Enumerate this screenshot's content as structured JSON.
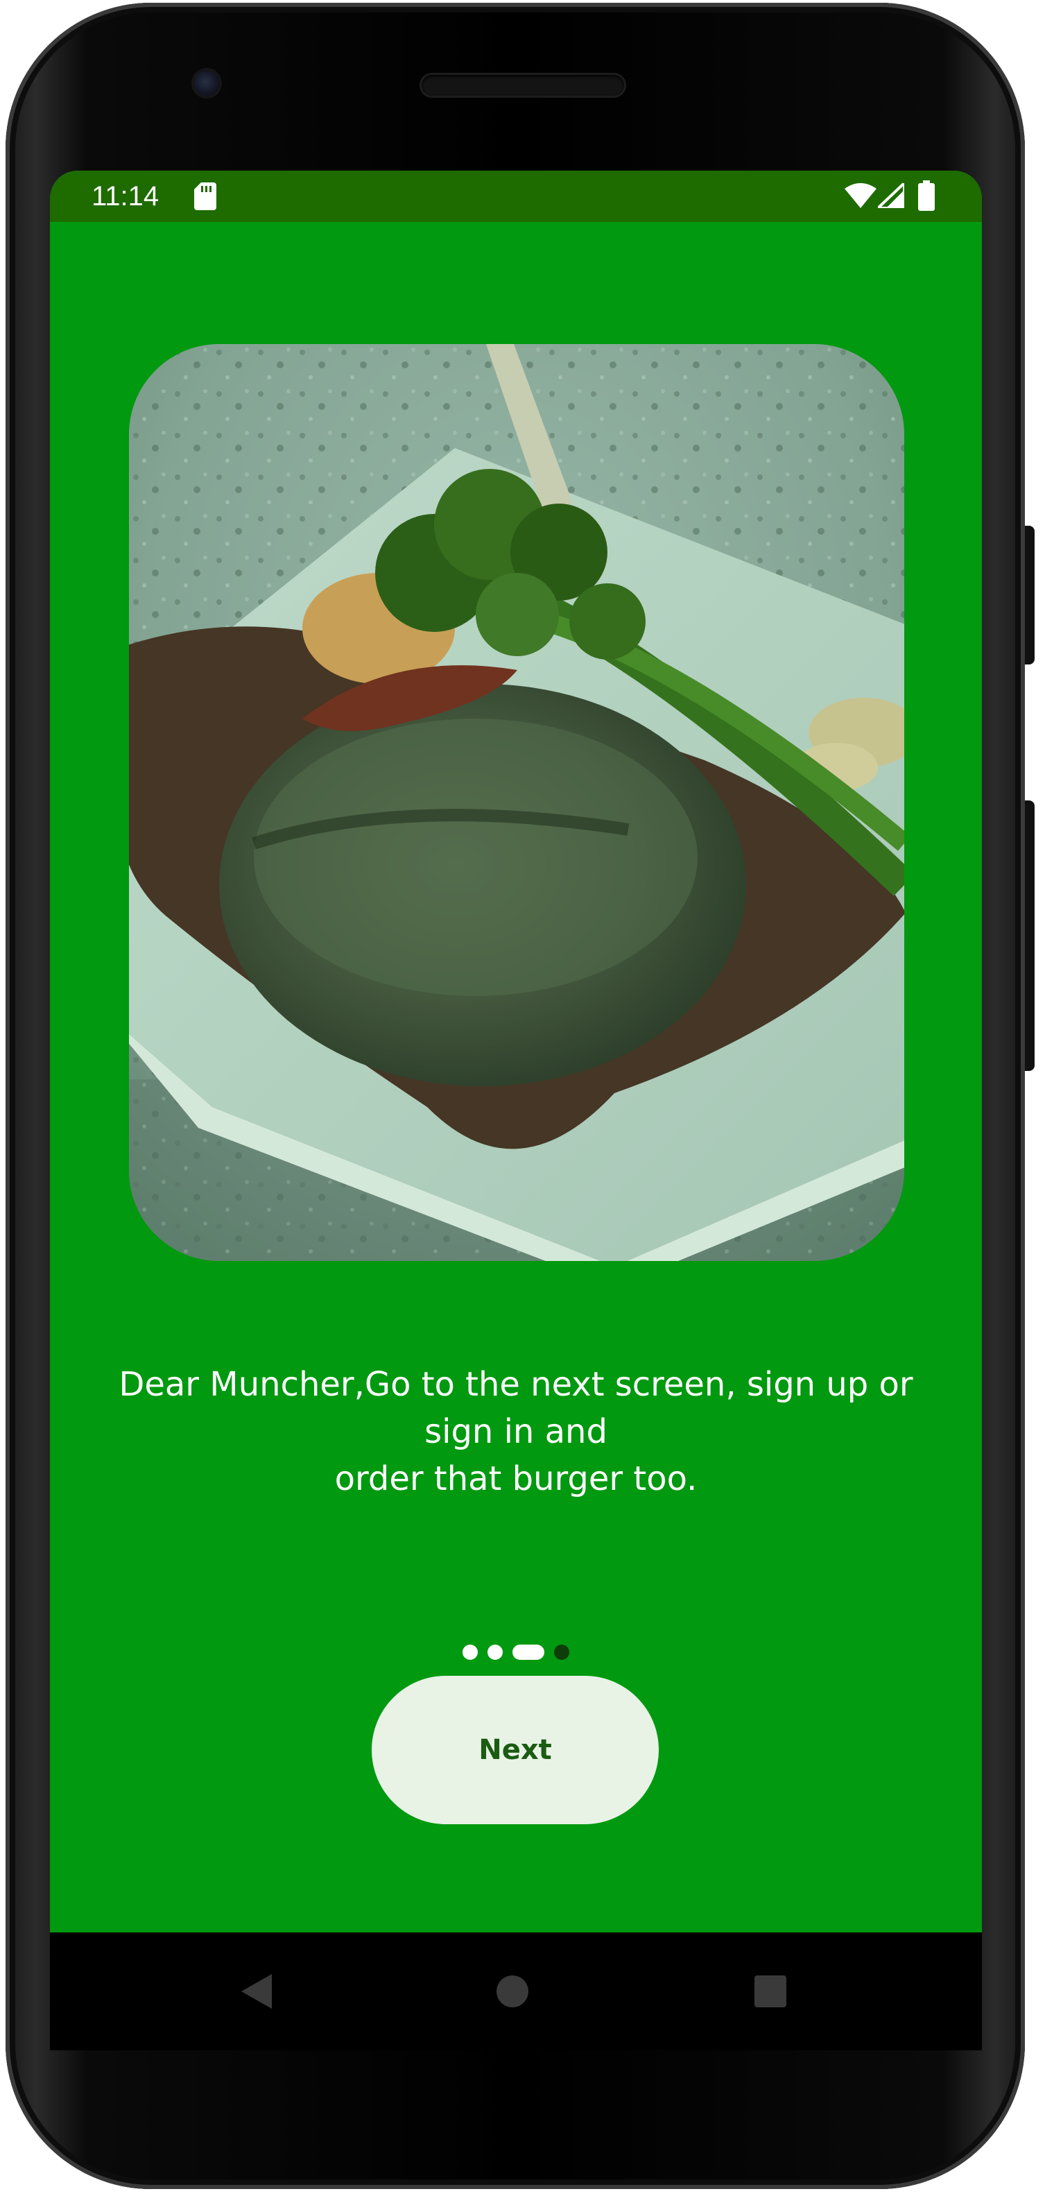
{
  "status_bar": {
    "time": "11:14",
    "icons": [
      "sd-card-icon",
      "wifi-icon",
      "signal-icon",
      "battery-icon"
    ]
  },
  "onboarding": {
    "image_description_icon": "steak-plate-image",
    "message_lines": [
      "Dear Muncher,Go to the next screen, sign up or",
      "sign in and",
      "order that burger too."
    ],
    "pager": {
      "total": 4,
      "active_index": 2,
      "indicator_style": "dots"
    },
    "next_label": "Next"
  },
  "nav_bar": {
    "icons": [
      "back-icon",
      "home-icon",
      "recents-icon"
    ]
  },
  "colors": {
    "background": "#00990f",
    "status_bar": "#1e6b00",
    "button_bg": "#e8f3e6",
    "button_text": "#1b5c12",
    "text": "#ffffff"
  }
}
